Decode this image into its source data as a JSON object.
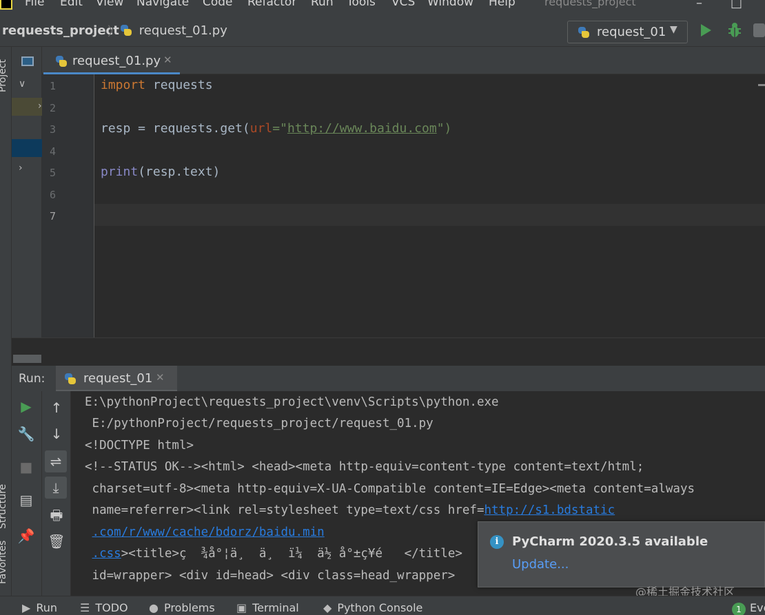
{
  "menu": {
    "items": [
      "File",
      "Edit",
      "View",
      "Navigate",
      "Code",
      "Refactor",
      "Run",
      "Tools",
      "VCS",
      "Window",
      "Help"
    ],
    "project_title": "requests_project"
  },
  "navbar": {
    "project": "requests_project",
    "file": "request_01.py",
    "run_config": "request_01"
  },
  "editor": {
    "tab_label": "request_01.py",
    "line_numbers": [
      "1",
      "2",
      "3",
      "4",
      "5",
      "6",
      "7"
    ],
    "code": {
      "l1_kw": "import",
      "l1_rest": " requests",
      "l3_a": "resp = requests.get(",
      "l3_param": "url",
      "l3_eq": "=\"",
      "l3_url": "http://www.baidu.com",
      "l3_end": "\")",
      "l5_fn": "print",
      "l5_rest": "(resp.text)"
    }
  },
  "run_panel": {
    "label": "Run:",
    "tab": "request_01",
    "output": {
      "l1": "E:\\pythonProject\\requests_project\\venv\\Scripts\\python.exe",
      "l2": " E:/pythonProject/requests_project/request_01.py",
      "l3": "<!DOCTYPE html>",
      "l4": "<!--STATUS OK--><html> <head><meta http-equiv=content-type content=text/html;",
      "l5": " charset=utf-8><meta http-equiv=X-UA-Compatible content=IE=Edge><meta content=always",
      "l6_a": " name=referrer><link rel=stylesheet type=text/css href=",
      "l6_link": "http://s1.bdstatic",
      "l7_link": ".com/r/www/cache/bdorz/baidu.min",
      "l8_link": ".css",
      "l8_rest": "><title>ç  ¾å°¦ä¸  ä¸  ï¼  ä½ å°±ç¥é   </title>",
      "l9": " id=wrapper> <div id=head> <div class=head_wrapper>",
      "l10": "                                                        "
    }
  },
  "notification": {
    "title": "PyCharm 2020.3.5 available",
    "link": "Update..."
  },
  "watermark": "@稀土掘金技术社区",
  "side_tabs": {
    "project": "Project",
    "structure": "Structure",
    "favorites": "Favorites"
  },
  "bottom_tabs": [
    "Run",
    "TODO",
    "Problems",
    "Terminal",
    "Python Console",
    "Eve"
  ],
  "event_count": "1"
}
